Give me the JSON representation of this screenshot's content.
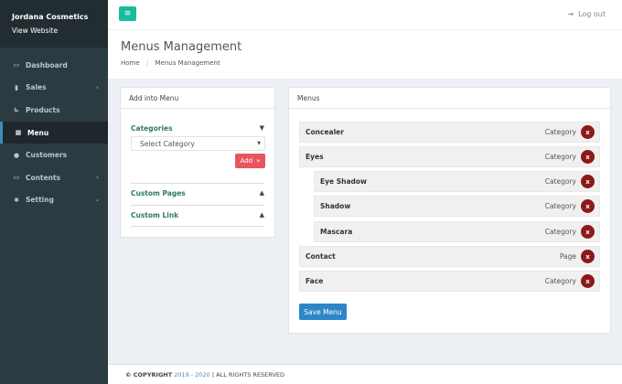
{
  "brand": {
    "name": "Jordana Cosmetics",
    "link": "View Website"
  },
  "sidebar": {
    "items": [
      {
        "label": "Dashboard",
        "icon": "monitor-icon"
      },
      {
        "label": "Sales",
        "icon": "chart-icon",
        "chevron": "‹"
      },
      {
        "label": "Products",
        "icon": "cart-icon"
      },
      {
        "label": "Menu",
        "icon": "grid-icon"
      },
      {
        "label": "Customers",
        "icon": "user-icon"
      },
      {
        "label": "Contents",
        "icon": "monitor-icon",
        "chevron": "‹"
      },
      {
        "label": "Setting",
        "icon": "gear-icon",
        "chevron": "‹"
      }
    ],
    "active": "Menu"
  },
  "topbar": {
    "logout": "Log out",
    "accent": "#1abc9c"
  },
  "header": {
    "title": "Menus Management",
    "breadcrumb": [
      "Home",
      "/",
      "Menus Management"
    ]
  },
  "add_panel": {
    "title": "Add into Menu",
    "categories_title": "Categories",
    "select_placeholder": "Select Category",
    "add_label": "Add",
    "add_symbol": "»",
    "custom_pages_title": "Custom Pages",
    "custom_link_title": "Custom Link"
  },
  "menus_panel": {
    "title": "Menus",
    "items": [
      {
        "label": "Concealer",
        "type": "Category",
        "level": 0
      },
      {
        "label": "Eyes",
        "type": "Category",
        "level": 0
      },
      {
        "label": "Eye Shadow",
        "type": "Category",
        "level": 1
      },
      {
        "label": "Shadow",
        "type": "Category",
        "level": 1
      },
      {
        "label": "Mascara",
        "type": "Category",
        "level": 1
      },
      {
        "label": "Contact",
        "type": "Page",
        "level": 0
      },
      {
        "label": "Face",
        "type": "Category",
        "level": 0
      }
    ],
    "delete_label": "x",
    "save_label": "Save Menu"
  },
  "footer": {
    "copyright": "© COPYRIGHT",
    "years": "2019 - 2020",
    "rights": "| ALL RIGHTS RESERVED"
  },
  "colors": {
    "sidebar": "#2c3b41",
    "add_button": "#e8555c",
    "save_button": "#2e86c8",
    "delete_button": "#8b1a1a",
    "section_title": "#2e7d5b"
  }
}
